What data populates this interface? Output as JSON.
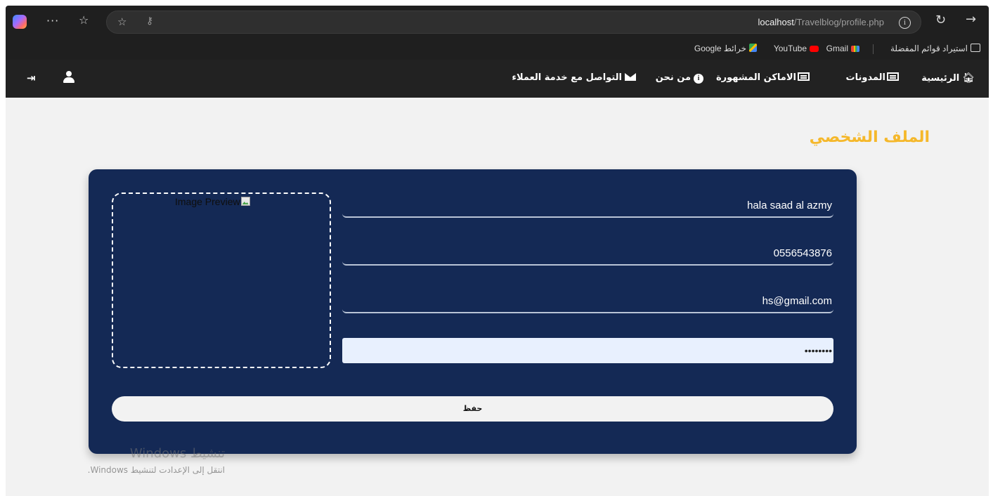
{
  "browser": {
    "address_host": "localhost",
    "address_path": "/Travelblog/profile.php",
    "bookmarks": {
      "import": "استيراد قوائم المفضلة",
      "gmail": "Gmail",
      "youtube": "YouTube",
      "maps": "خرائط Google"
    }
  },
  "nav": {
    "home": "الرئيسية",
    "blogs": "المدونات",
    "places": "الاماكن المشهورة",
    "about": "من نحن",
    "contact": "التواصل مع خدمة العملاء"
  },
  "page": {
    "title": "الملف الشخصي",
    "preview_alt": "Image Preview",
    "name": "hala saad al azmy",
    "phone": "0556543876",
    "email": "hs@gmail.com",
    "password_mask": "••••••••",
    "save_label": "حفظ"
  },
  "watermark": {
    "line1": "تنشيط Windows",
    "line2": "انتقل إلى الإعدادت لتنشيط Windows."
  },
  "colors": {
    "card_bg": "#142955",
    "title": "#f5b82b",
    "nav_bg": "#222222",
    "page_bg": "#f2f2f2"
  }
}
